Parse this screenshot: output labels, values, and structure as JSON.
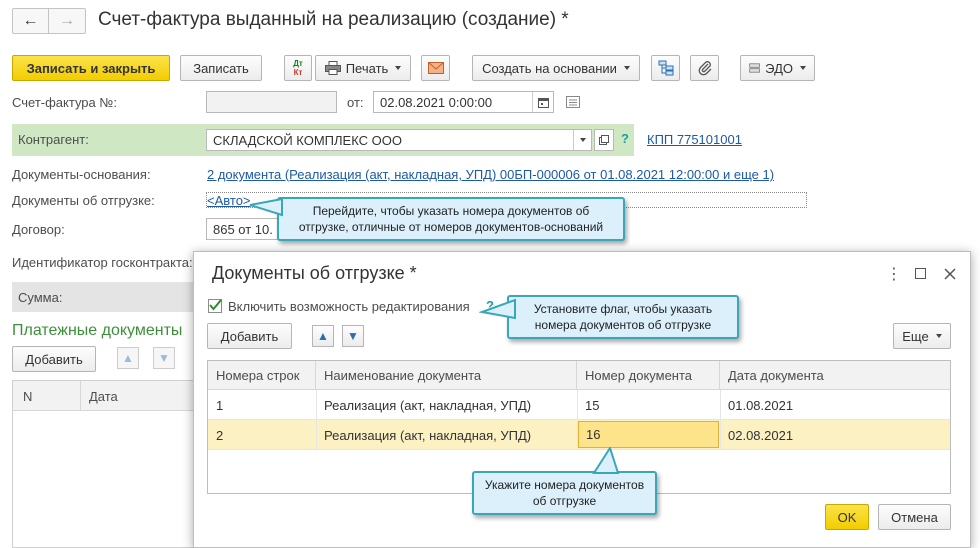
{
  "window": {
    "title": "Счет-фактура выданный на реализацию (создание) *",
    "nav_back": "←",
    "nav_forward": "→"
  },
  "toolbar": {
    "save_close": "Записать и закрыть",
    "save": "Записать",
    "dtkt_top": "Дт",
    "dtkt_bottom": "Кт",
    "print": "Печать",
    "create_based": "Создать на основании",
    "edo": "ЭДО"
  },
  "form": {
    "invoice_label": "Счет-фактура №:",
    "invoice_number": "",
    "from_label": "от:",
    "date": "02.08.2021  0:00:00",
    "counterparty_label": "Контрагент:",
    "counterparty": "СКЛАДСКОЙ КОМПЛЕКС ООО",
    "help": "?",
    "kpp_link": "КПП 775101001",
    "base_docs_label": "Документы-основания:",
    "base_docs_link": "2 документа (Реализация (акт, накладная, УПД) 00БП-000006 от 01.08.2021 12:00:00 и еще 1)",
    "shipment_docs_label": "Документы об отгрузке:",
    "shipment_docs_link": "<Авто>",
    "contract_label": "Договор:",
    "contract_value": "865 от 10.",
    "gov_contract_label": "Идентификатор госконтракта:",
    "sum_label": "Сумма:",
    "payments_header": "Платежные документы",
    "add_button": "Добавить",
    "table_col_n": "N",
    "table_col_date": "Дата"
  },
  "tooltips": {
    "shipment_link": "Перейдите, чтобы указать номера документов об отгрузке, отличные от номеров документов-оснований",
    "edit_flag": "Установите флаг, чтобы указать номера документов об отгрузке",
    "doc_number": "Укажите номера документов об отгрузке"
  },
  "dialog": {
    "title": "Документы об отгрузке *",
    "menu_icon": "⋮",
    "checkbox_label": "Включить возможность редактирования",
    "checkbox_checked": true,
    "help": "?",
    "add_button": "Добавить",
    "more_button": "Еще",
    "columns": [
      "Номера строк",
      "Наименование документа",
      "Номер документа",
      "Дата документа"
    ],
    "rows": [
      {
        "n": "1",
        "name": "Реализация (акт, накладная, УПД)",
        "number": "15",
        "date": "01.08.2021"
      },
      {
        "n": "2",
        "name": "Реализация (акт, накладная, УПД)",
        "number": "16",
        "date": "02.08.2021"
      }
    ],
    "ok": "OK",
    "cancel": "Отмена"
  }
}
